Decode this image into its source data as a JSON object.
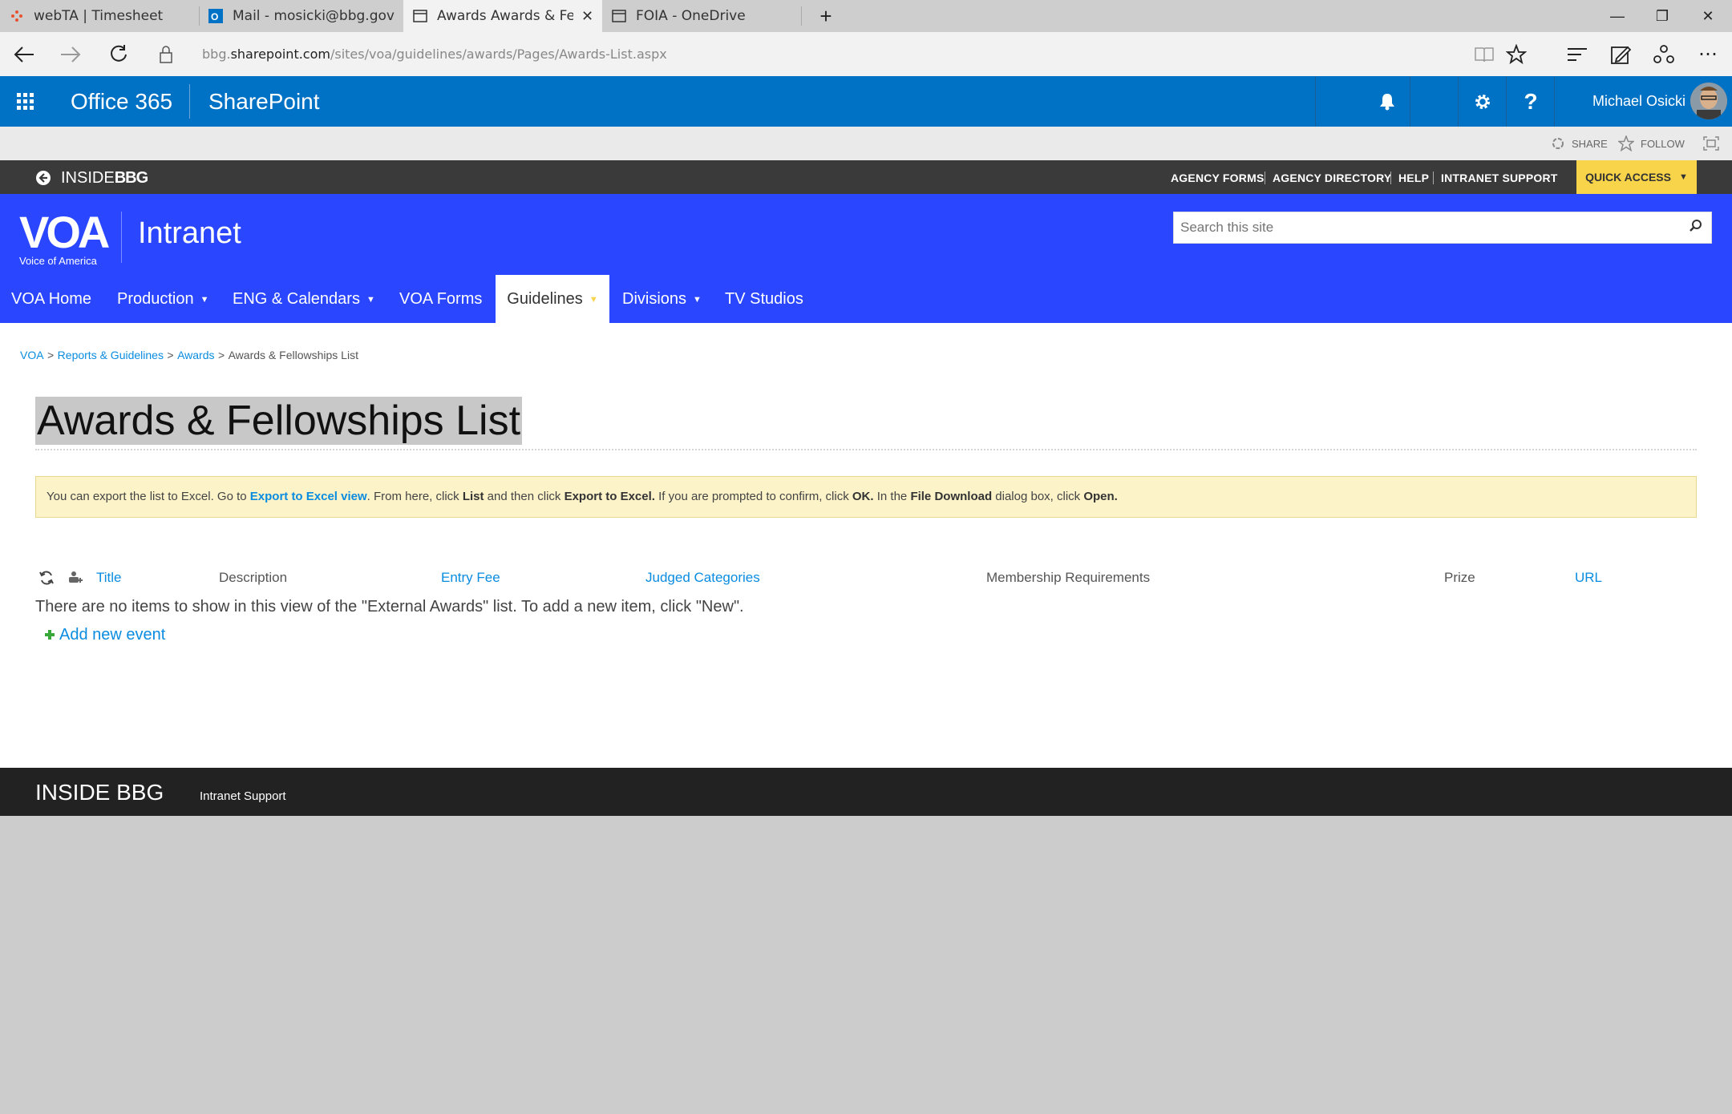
{
  "browser": {
    "tabs": [
      {
        "label": "webTA | Timesheet",
        "icon": "webta-icon"
      },
      {
        "label": "Mail - mosicki@bbg.gov",
        "icon": "outlook-icon"
      },
      {
        "label": "Awards Awards & Fellov",
        "icon": "page-icon"
      },
      {
        "label": "FOIA - OneDrive",
        "icon": "page-icon"
      }
    ],
    "new_tab": "+",
    "url_prefix": "bbg.",
    "url_domain": "sharepoint.com",
    "url_path": "/sites/voa/guidelines/awards/Pages/Awards-List.aspx"
  },
  "o365": {
    "app_name": "Office 365",
    "product": "SharePoint",
    "user_name": "Michael Osicki"
  },
  "page_actions": {
    "share": "SHARE",
    "follow": "FOLLOW"
  },
  "topbar": {
    "brand_left": "INSIDE",
    "brand_right": "BBG",
    "links": [
      "AGENCY FORMS",
      "AGENCY DIRECTORY",
      "HELP",
      "INTRANET SUPPORT"
    ],
    "quick_access": "QUICK ACCESS"
  },
  "site": {
    "logo_text": "VOA",
    "logo_subtitle": "Voice of America",
    "title": "Intranet",
    "search_placeholder": "Search this site",
    "nav": [
      {
        "label": "VOA Home",
        "dropdown": false
      },
      {
        "label": "Production",
        "dropdown": true
      },
      {
        "label": "ENG & Calendars",
        "dropdown": true
      },
      {
        "label": "VOA Forms",
        "dropdown": false
      },
      {
        "label": "Guidelines",
        "dropdown": true
      },
      {
        "label": "Divisions",
        "dropdown": true
      },
      {
        "label": "TV Studios",
        "dropdown": false
      }
    ]
  },
  "breadcrumb": {
    "items": [
      "VOA",
      "Reports & Guidelines",
      "Awards"
    ],
    "current": "Awards & Fellowships List",
    "separator": ">"
  },
  "page": {
    "title": "Awards & Fellowships List",
    "notice": {
      "t1": "You can export the list to Excel. Go to ",
      "link": "Export to Excel view",
      "t2": ". From here, click ",
      "b1": "List",
      "t3": " and then click ",
      "b2": "Export to Excel.",
      "t4": " If you are prompted to confirm, click ",
      "b3": "OK.",
      "t5": " In the ",
      "b4": "File Download",
      "t6": " dialog box, click ",
      "b5": "Open."
    },
    "columns": [
      "Title",
      "Description",
      "Entry Fee",
      "Judged Categories",
      "Membership Requirements",
      "Prize",
      "URL"
    ],
    "empty_message": "There are no items to show in this view of the \"External Awards\" list. To add a new item, click \"New\".",
    "add_new": "Add new event"
  },
  "footer": {
    "brand": "INSIDE BBG",
    "link": "Intranet Support"
  },
  "colors": {
    "o365_blue": "#0072c6",
    "site_blue": "#2a46fe",
    "quick_access": "#f7d44a",
    "link": "#0a8ce0",
    "notice_bg": "#fcf3c9"
  }
}
